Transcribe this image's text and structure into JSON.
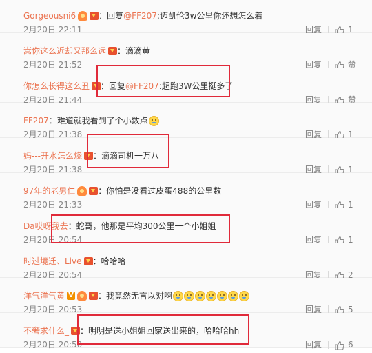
{
  "reply_label": "回复",
  "comments": [
    {
      "user": "Gorgeousni6",
      "user_color": "#eb7350",
      "badges": [
        "fan",
        "member"
      ],
      "reply_prefix": "回复",
      "mention": "@FF207",
      "text": "迈凯伦3w公里你还想怎么着",
      "emojis": 0,
      "time": "2月20日 22:11",
      "likes": "1"
    },
    {
      "user": "嵩你这么近却又那么远",
      "user_color": "#eb7350",
      "badges": [
        "member"
      ],
      "reply_prefix": "",
      "mention": "",
      "text": "滴滴黄",
      "emojis": 0,
      "time": "2月20日 21:52",
      "likes": "赞"
    },
    {
      "user": "你怎么长得这么丑",
      "user_color": "#eb7350",
      "badges": [
        "member"
      ],
      "reply_prefix": "回复",
      "mention": "@FF207",
      "text": "超跑3W公里挺多了",
      "emojis": 0,
      "time": "2月20日 21:44",
      "likes": "赞"
    },
    {
      "user": "FF207",
      "user_color": "#eb7350",
      "badges": [],
      "reply_prefix": "",
      "mention": "",
      "text": "难道就我看到了个小数点",
      "emojis": 1,
      "time": "2月20日 21:38",
      "likes": "1"
    },
    {
      "user": "妈---开水怎么烧",
      "user_color": "#eb7350",
      "badges": [
        "member"
      ],
      "reply_prefix": "",
      "mention": "",
      "text": "滴滴司机一万八",
      "emojis": 0,
      "time": "2月20日 21:38",
      "likes": "1"
    },
    {
      "user": "97年的老男仁",
      "user_color": "#eb7350",
      "badges": [
        "fan",
        "member"
      ],
      "reply_prefix": "",
      "mention": "",
      "text": "你怕是没看过皮蛋488的公里数",
      "emojis": 0,
      "time": "2月20日 21:33",
      "likes": "1"
    },
    {
      "user": "Da哎呀我去",
      "user_color": "#eb7350",
      "badges": [],
      "reply_prefix": "",
      "mention": "",
      "text": "蛇哥，他那是平均300公里一个小姐姐",
      "emojis": 0,
      "time": "2月20日 20:54",
      "likes": "1"
    },
    {
      "user": "时过境迁、Live",
      "user_color": "#eb7350",
      "badges": [
        "member"
      ],
      "reply_prefix": "",
      "mention": "",
      "text": "哈哈哈",
      "emojis": 0,
      "time": "2月20日 20:54",
      "likes": "2"
    },
    {
      "user": "洋气洋气黄",
      "user_color": "#eb7350",
      "badges": [
        "vip",
        "fan",
        "member"
      ],
      "reply_prefix": "",
      "mention": "",
      "text": "我竟然无言以对啊",
      "emojis": 7,
      "time": "2月20日 20:53",
      "likes": "5"
    },
    {
      "user": "不奢求什么_",
      "user_color": "#eb7350",
      "badges": [
        "member"
      ],
      "reply_prefix": "",
      "mention": "",
      "text": "明明是送小姐姐回家送出来的，哈哈哈hh",
      "emojis": 0,
      "time": "2月20日 20:50",
      "likes": "6"
    }
  ]
}
